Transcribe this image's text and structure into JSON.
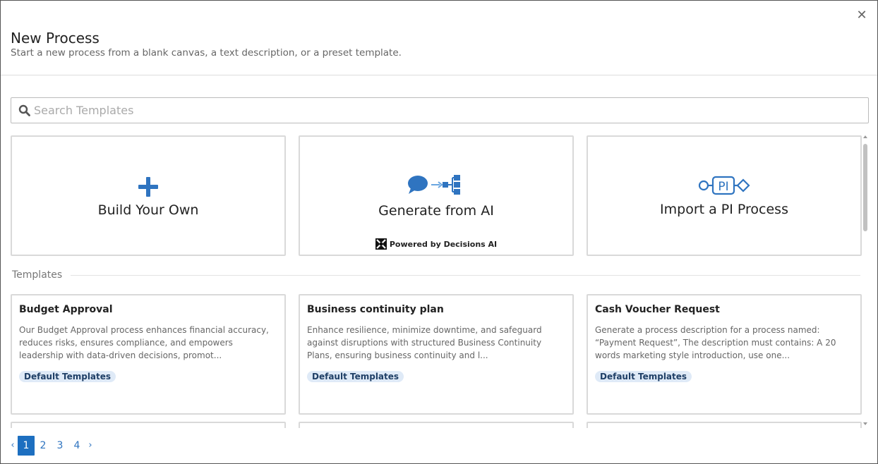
{
  "dialog": {
    "title": "New Process",
    "subtitle": "Start a new process from a blank canvas, a text description, or a preset template.",
    "close_icon": "close-icon"
  },
  "search": {
    "placeholder": "Search Templates",
    "icon": "search-icon"
  },
  "start_options": [
    {
      "label": "Build Your Own",
      "icon": "plus-icon"
    },
    {
      "label": "Generate from AI",
      "icon": "chat-to-flow-icon",
      "powered_by": "Powered by Decisions AI"
    },
    {
      "label": "Import a PI Process",
      "icon": "pi-process-icon"
    }
  ],
  "templates_section": {
    "label": "Templates",
    "items": [
      {
        "name": "Budget Approval",
        "description": "Our Budget Approval process enhances financial accuracy, reduces risks, ensures compliance, and empowers leadership with data-driven decisions, promot...",
        "badge": "Default Templates"
      },
      {
        "name": "Business continuity plan",
        "description": "Enhance resilience, minimize downtime, and safeguard against disruptions with structured Business Continuity Plans, ensuring business continuity and l...",
        "badge": "Default Templates"
      },
      {
        "name": "Cash Voucher Request",
        "description": "Generate a process description for a process named: “Payment Request”, The description must contains: A 20 words marketing style introduction, use one...",
        "badge": "Default Templates"
      }
    ]
  },
  "pagination": {
    "prev": "‹",
    "next": "›",
    "pages": [
      "1",
      "2",
      "3",
      "4"
    ],
    "current": "1"
  },
  "colors": {
    "accent": "#1d6fc0",
    "icon_blue": "#2f74c0",
    "badge_bg": "#dfeaf7",
    "badge_text": "#1f3f66"
  }
}
